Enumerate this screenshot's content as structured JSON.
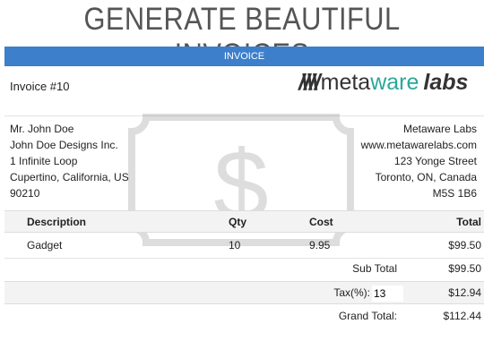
{
  "banner": "GENERATE BEAUTIFUL INVOICES",
  "header": "INVOICE",
  "invoice_number": "Invoice #10",
  "logo": {
    "mark": "/\\/\\/\\/",
    "meta": "meta",
    "ware": "ware",
    "labs": "labs",
    "accent": "#2aa79b"
  },
  "watermark_icon": "dollar-bill-icon",
  "from": [
    "Mr. John Doe",
    "John Doe Designs Inc.",
    "1 Infinite Loop",
    "Cupertino, California, US",
    "90210"
  ],
  "to": [
    "Metaware Labs",
    "www.metawarelabs.com",
    "123 Yonge Street",
    "Toronto, ON, Canada",
    "M5S 1B6"
  ],
  "table": {
    "headers": {
      "description": "Description",
      "qty": "Qty",
      "cost": "Cost",
      "total": "Total"
    },
    "rows": [
      {
        "description": "Gadget",
        "qty": "10",
        "cost": "9.95",
        "total": "$99.50"
      }
    ]
  },
  "totals": {
    "sub_label": "Sub Total",
    "sub": "$99.50",
    "tax_label": "Tax(%):",
    "tax_rate": "13",
    "tax": "$12.94",
    "grand_label": "Grand Total:",
    "grand": "$112.44"
  },
  "colors": {
    "header_bar": "#3d7fcb"
  }
}
